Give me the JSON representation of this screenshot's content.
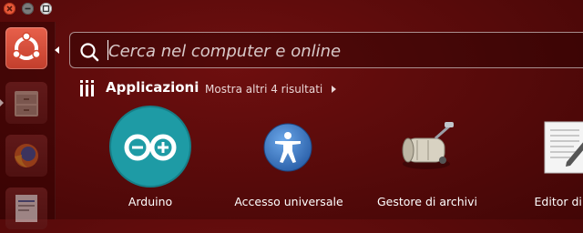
{
  "window_controls": {
    "close_icon": "close-icon",
    "minimize_icon": "minimize-icon",
    "maximize_icon": "maximize-icon"
  },
  "launcher": {
    "items": [
      {
        "name": "ubuntu-dash",
        "icon": "ubuntu-logo-icon",
        "active": true
      },
      {
        "name": "files",
        "icon": "file-cabinet-icon"
      },
      {
        "name": "firefox",
        "icon": "firefox-icon"
      },
      {
        "name": "writer",
        "icon": "writer-document-icon"
      }
    ]
  },
  "search": {
    "placeholder": "Cerca nel computer e online",
    "value": "",
    "icon": "search-icon"
  },
  "category": {
    "title": "Applicazioni",
    "more_label": "Mostra altri 4 risultati",
    "icon": "applications-category-icon"
  },
  "apps": [
    {
      "label": "Arduino",
      "icon": "arduino-icon"
    },
    {
      "label": "Accesso universale",
      "icon": "universal-access-icon"
    },
    {
      "label": "Gestore di archivi",
      "icon": "archive-manager-icon"
    },
    {
      "label": "Editor di te",
      "icon": "text-editor-icon"
    }
  ],
  "colors": {
    "background": "#560a0a",
    "dash_accent": "#dd4814",
    "arduino_teal": "#1e9ba5"
  }
}
